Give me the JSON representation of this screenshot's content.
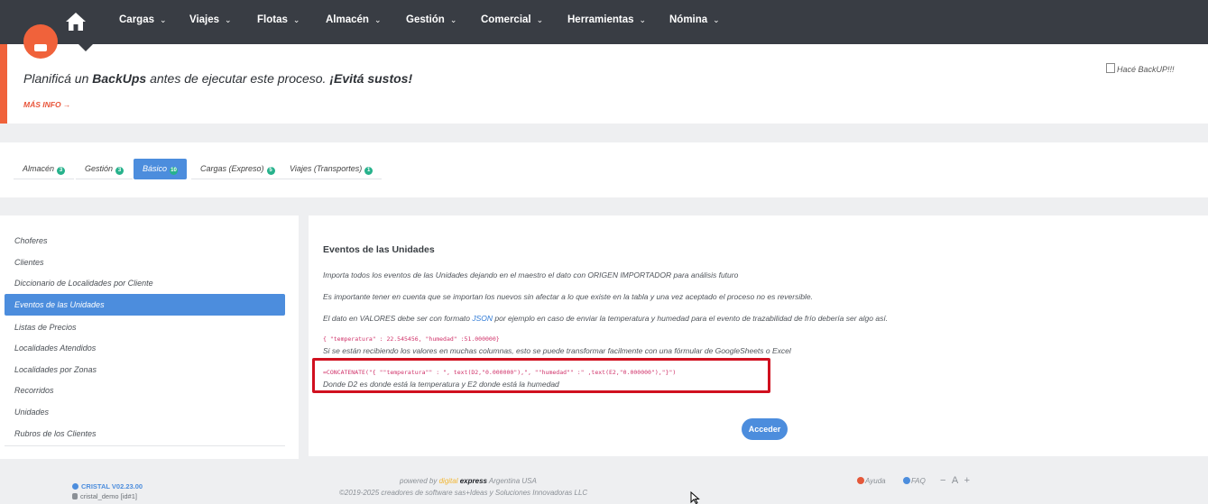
{
  "nav": {
    "items": [
      {
        "label": "Cargas"
      },
      {
        "label": "Viajes"
      },
      {
        "label": "Flotas"
      },
      {
        "label": "Almacén"
      },
      {
        "label": "Gestión"
      },
      {
        "label": "Comercial"
      },
      {
        "label": "Herramientas"
      },
      {
        "label": "Nómina"
      }
    ]
  },
  "banner": {
    "text_pre": "Planificá un ",
    "text_bold": "BackUps",
    "text_mid": " antes de ejecutar este proceso. ",
    "text_emph": "¡Evitá sustos!",
    "more_label": "MÁS INFO →",
    "image_alt": "Hacé BackUP!!!",
    "accent_color": "#f0623b"
  },
  "tabs": [
    {
      "label": "Almacén",
      "badge": "3",
      "active": false
    },
    {
      "label": "Gestión",
      "badge": "3",
      "active": false
    },
    {
      "label": "Básico",
      "badge": "10",
      "active": true
    },
    {
      "label": "Cargas (Expreso)",
      "badge": "5",
      "active": false
    },
    {
      "label": "Viajes (Transportes)",
      "badge": "1",
      "active": false
    }
  ],
  "sidebar": {
    "items": [
      {
        "label": "Choferes",
        "active": false
      },
      {
        "label": "Clientes",
        "active": false
      },
      {
        "label": "Diccionario de Localidades por Cliente",
        "active": false
      },
      {
        "label": "Eventos de las Unidades",
        "active": true
      },
      {
        "label": "Listas de Precios",
        "active": false
      },
      {
        "label": "Localidades Atendidos",
        "active": false
      },
      {
        "label": "Localidades por Zonas",
        "active": false
      },
      {
        "label": "Recorridos",
        "active": false
      },
      {
        "label": "Unidades",
        "active": false
      },
      {
        "label": "Rubros de los Clientes",
        "active": false
      }
    ]
  },
  "main": {
    "title": "Eventos de las Unidades",
    "p1": "Importa todos los eventos de las Unidades dejando en el maestro el dato con ORIGEN IMPORTADOR para análisis futuro",
    "p2": "Es importante tener en cuenta que se importan los nuevos sin afectar a lo que existe en la tabla y una vez aceptado el proceso no es reversible.",
    "p3_pre": "El dato en VALORES debe ser con formato ",
    "p3_link": "JSON",
    "p3_post": " por ejemplo en caso de enviar la temperatura y humedad para el evento de trazabilidad de frío debería ser algo así.",
    "code1": "{ \"temperatura\" : 22.545456, \"humedad\" :51.000000}",
    "p4": "Si se están recibiendo los valores en muchas columnas, esto se puede transformar facilmente con una fórmular de GoogleSheets o Excel",
    "code2": "=CONCATENATE(\"{ \"\"temperatura\"\" : \", text(D2,\"0.000000\"),\", \"\"humedad\"\" :\" ,text(E2,\"0.000000\"),\"}\")",
    "p5": "Donde D2 es donde está la temperatura y E2 donde está la humedad",
    "button_label": "Acceder",
    "highlight_color": "#d0101f"
  },
  "footer": {
    "version": "CRISTAL V02.23.00",
    "user": "cristal_demo [id#1]",
    "powered_pre": "powered by ",
    "powered_digital": "digital",
    "powered_express": " express",
    "powered_post": " Argentina USA",
    "copyright": "©2019-2025 creadores de software sas+Ideas y Soluciones Innovadoras LLC",
    "help_label": "Ayuda",
    "faq_label": "FAQ",
    "font_controls": "− A +"
  }
}
